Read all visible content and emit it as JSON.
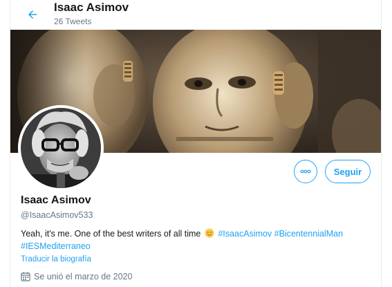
{
  "header": {
    "title": "Isaac Asimov",
    "subtitle": "26 Tweets",
    "back_icon": "arrow-left-icon"
  },
  "banner": {
    "description_icon": "robot-faces-banner-image"
  },
  "profile": {
    "name": "Isaac Asimov",
    "handle": "@IsaacAsimov533",
    "bio_text": "Yeah, it's me. One of the best writers of all time",
    "bio_emoji": "relieved-face-emoji",
    "hashtags": [
      "#IsaacAsimov",
      "#BicentennialMan",
      "#IESMediterraneo"
    ],
    "translate_label": "Traducir la biografía",
    "joined_label": "Se unió el marzo de 2020",
    "joined_icon": "calendar-icon"
  },
  "actions": {
    "more_icon": "more-options-icon",
    "follow_label": "Seguir"
  },
  "colors": {
    "accent": "#1da1f2",
    "text": "#14171a",
    "secondary": "#657786",
    "border": "#e6ecf0"
  }
}
